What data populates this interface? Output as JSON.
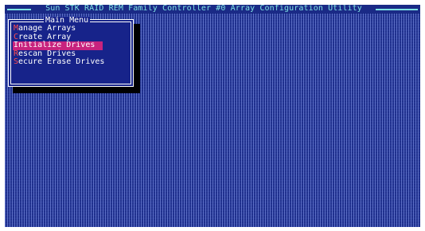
{
  "window": {
    "title": "Sun STK RAID REM Family Controller #0 Array Configuration Utility"
  },
  "main_menu": {
    "title": "Main Menu",
    "items": [
      {
        "hotkey": "M",
        "rest": "anage Arrays",
        "selected": false
      },
      {
        "hotkey": "C",
        "rest": "reate Array",
        "selected": false
      },
      {
        "hotkey": "I",
        "rest": "nitialize Drives",
        "selected": true
      },
      {
        "hotkey": "R",
        "rest": "escan Drives",
        "selected": false
      },
      {
        "hotkey": "S",
        "rest": "ecure Erase Drives",
        "selected": false
      }
    ]
  },
  "colors": {
    "background": "#1a2a86",
    "title_text": "#7fe3e3",
    "highlight": "#c8237e",
    "hotkey": "#ff4d4d"
  }
}
